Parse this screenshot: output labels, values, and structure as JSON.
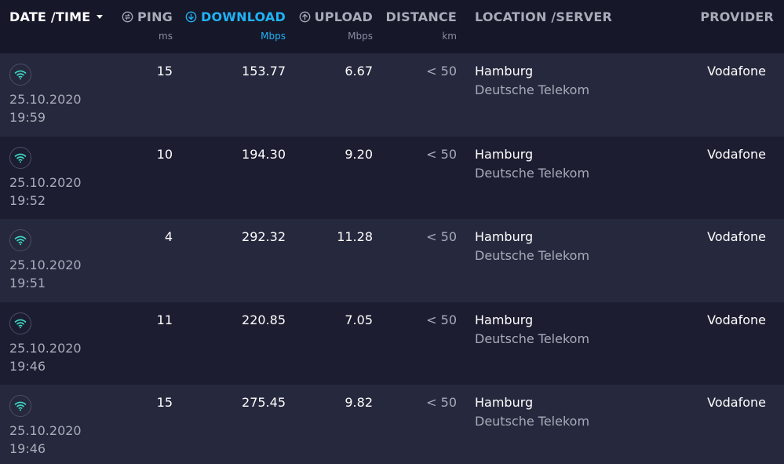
{
  "header": {
    "date_time": "DATE /TIME",
    "ping": "PING",
    "download": "DOWNLOAD",
    "upload": "UPLOAD",
    "distance": "DISTANCE",
    "location_server": "LOCATION /SERVER",
    "provider": "PROVIDER"
  },
  "units": {
    "ping": "ms",
    "download": "Mbps",
    "upload": "Mbps",
    "distance": "km"
  },
  "colors": {
    "accent": "#1fb3f5",
    "wifi_icon": "#3ddbc7",
    "header_bg": "#161729",
    "row_odd": "#26283d",
    "row_even": "#1c1d30"
  },
  "icons": {
    "ping": "ping-icon",
    "download": "download-arrow-icon",
    "upload": "upload-arrow-icon",
    "connection": "wifi-icon",
    "sort": "sort-caret-down-icon"
  },
  "rows": [
    {
      "date": "25.10.2020",
      "time": "19:59",
      "ping": "15",
      "download": "153.77",
      "upload": "6.67",
      "distance": "< 50",
      "location": "Hamburg",
      "server": "Deutsche Telekom",
      "provider": "Vodafone"
    },
    {
      "date": "25.10.2020",
      "time": "19:52",
      "ping": "10",
      "download": "194.30",
      "upload": "9.20",
      "distance": "< 50",
      "location": "Hamburg",
      "server": "Deutsche Telekom",
      "provider": "Vodafone"
    },
    {
      "date": "25.10.2020",
      "time": "19:51",
      "ping": "4",
      "download": "292.32",
      "upload": "11.28",
      "distance": "< 50",
      "location": "Hamburg",
      "server": "Deutsche Telekom",
      "provider": "Vodafone"
    },
    {
      "date": "25.10.2020",
      "time": "19:46",
      "ping": "11",
      "download": "220.85",
      "upload": "7.05",
      "distance": "< 50",
      "location": "Hamburg",
      "server": "Deutsche Telekom",
      "provider": "Vodafone"
    },
    {
      "date": "25.10.2020",
      "time": "19:46",
      "ping": "15",
      "download": "275.45",
      "upload": "9.82",
      "distance": "< 50",
      "location": "Hamburg",
      "server": "Deutsche Telekom",
      "provider": "Vodafone"
    }
  ]
}
